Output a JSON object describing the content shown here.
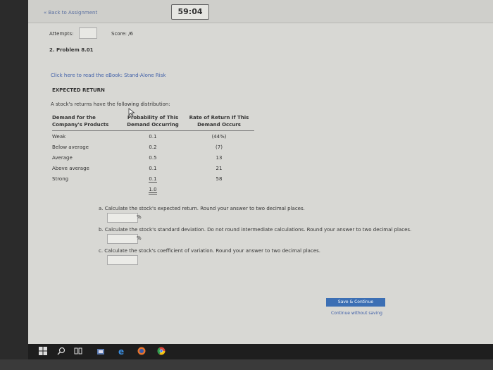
{
  "header": {
    "back_link": "« Back to Assignment",
    "timer": "59:04"
  },
  "status": {
    "attempts_label": "Attempts:",
    "attempts_value": "",
    "score_label": "Score: /6"
  },
  "problem": {
    "title": "2. Problem 8.01",
    "ebook_link": "Click here to read the eBook: Stand-Alone Risk",
    "section_title": "EXPECTED RETURN",
    "intro": "A stock's returns have the following distribution:"
  },
  "table": {
    "headers": [
      "Demand for the Company's Products",
      "Probability of This Demand Occurring",
      "Rate of Return If This Demand Occurs"
    ],
    "rows": [
      {
        "demand": "Weak",
        "probability": "0.1",
        "return": "(44%)"
      },
      {
        "demand": "Below average",
        "probability": "0.2",
        "return": "(7)"
      },
      {
        "demand": "Average",
        "probability": "0.5",
        "return": "13"
      },
      {
        "demand": "Above average",
        "probability": "0.1",
        "return": "21"
      },
      {
        "demand": "Strong",
        "probability": "0.1",
        "return": "58"
      }
    ],
    "total_probability": "1.0"
  },
  "questions": {
    "a": {
      "text": "a. Calculate the stock's expected return. Round your answer to two decimal places.",
      "unit": "%",
      "value": ""
    },
    "b": {
      "text": "b. Calculate the stock's standard deviation. Do not round intermediate calculations. Round your answer to two decimal places.",
      "unit": "%",
      "value": ""
    },
    "c": {
      "text": "c. Calculate the stock's coefficient of variation. Round your answer to two decimal places.",
      "value": ""
    }
  },
  "actions": {
    "save_continue": "Save & Continue",
    "continue_without_saving": "Continue without saving"
  },
  "taskbar": {
    "icons": [
      "windows-icon",
      "search-icon",
      "task-view-icon",
      "store-icon",
      "edge-icon",
      "firefox-icon",
      "chrome-icon"
    ]
  }
}
